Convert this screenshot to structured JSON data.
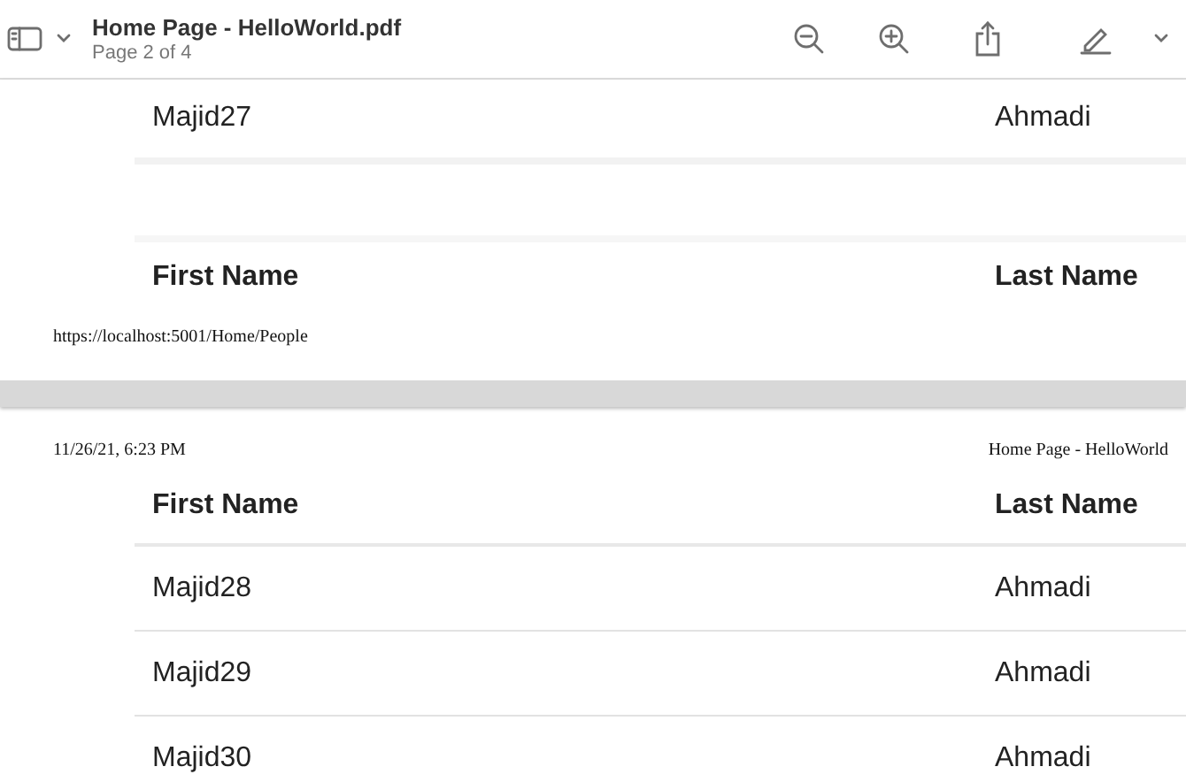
{
  "window": {
    "title": "Home Page - HelloWorld.pdf",
    "subtitle": "Page 2 of 4"
  },
  "pages": [
    {
      "rows": [
        {
          "first_name": "Majid27",
          "last_name": "Ahmadi"
        }
      ],
      "columns": [
        "First Name",
        "Last Name"
      ],
      "footer_url": "https://localhost:5001/Home/People"
    },
    {
      "print_date": "11/26/21, 6:23 PM",
      "print_title": "Home Page - HelloWorld",
      "columns": [
        "First Name",
        "Last Name"
      ],
      "rows": [
        {
          "first_name": "Majid28",
          "last_name": "Ahmadi"
        },
        {
          "first_name": "Majid29",
          "last_name": "Ahmadi"
        },
        {
          "first_name": "Majid30",
          "last_name": "Ahmadi"
        }
      ]
    }
  ]
}
